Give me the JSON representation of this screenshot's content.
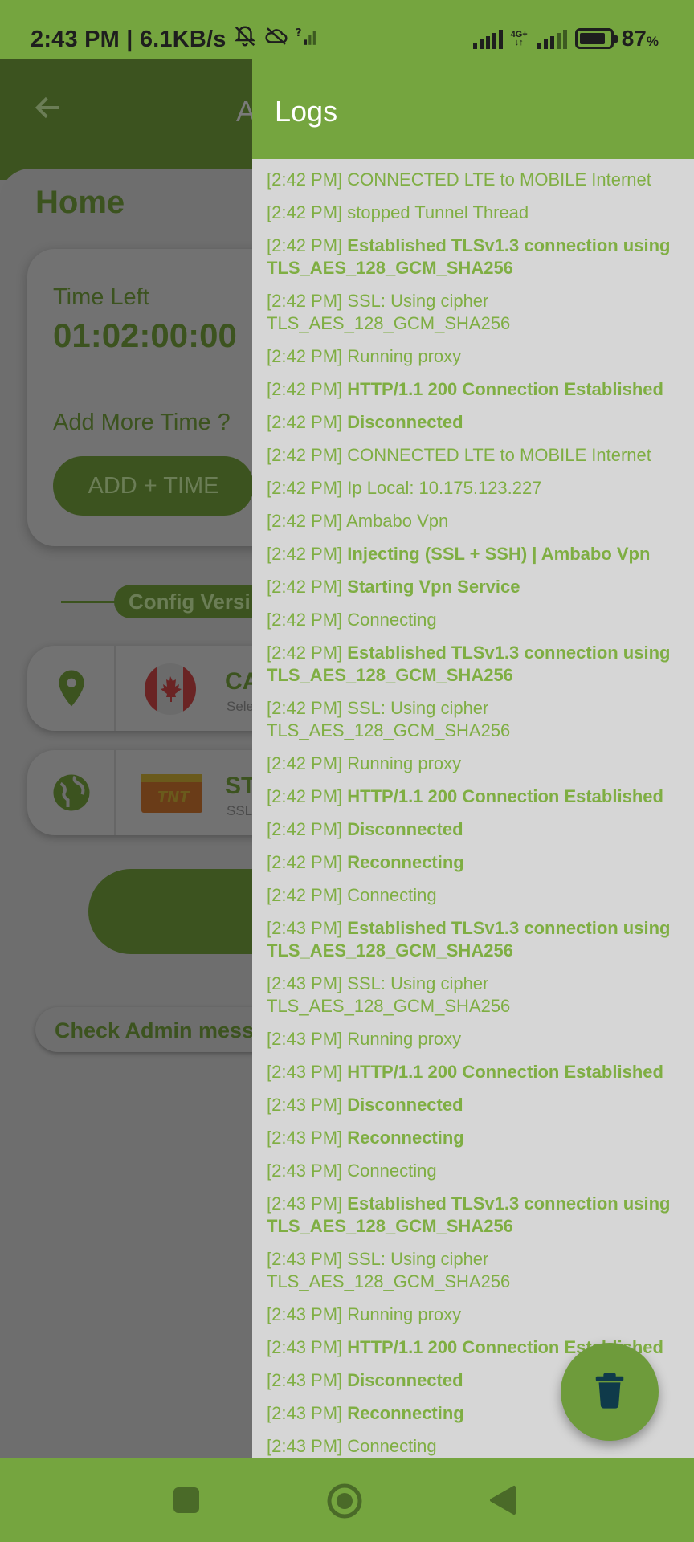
{
  "status_bar": {
    "time_speed": "2:43 PM | 6.1KB/s",
    "network_type": "4G+",
    "battery_percent": "87",
    "battery_unit": "%",
    "battery_level": 0.87
  },
  "background_app": {
    "title_fragment": "A",
    "home_title": "Home",
    "time_left_label": "Time Left",
    "time_left_value": "01:02:00:00",
    "add_more_time_label": "Add More Time ?",
    "add_time_button": "ADD + TIME",
    "config_version_label": "Config Versi",
    "server": {
      "code": "CA",
      "sub": "Sele"
    },
    "payload": {
      "code": "ST",
      "sub": "SSL"
    },
    "admin_message": "Check Admin messa"
  },
  "logs": {
    "title": "Logs",
    "entries": [
      {
        "time": "[2:42 PM]",
        "message": "CONNECTED LTE to MOBILE Internet",
        "bold": false
      },
      {
        "time": "[2:42 PM]",
        "message": "stopped Tunnel Thread",
        "bold": false
      },
      {
        "time": "[2:42 PM]",
        "message": "Established TLSv1.3 connection using TLS_AES_128_GCM_SHA256",
        "bold": true
      },
      {
        "time": "[2:42 PM]",
        "message": "SSL: Using cipher TLS_AES_128_GCM_SHA256",
        "bold": false
      },
      {
        "time": "[2:42 PM]",
        "message": "Running proxy",
        "bold": false
      },
      {
        "time": "[2:42 PM]",
        "message": "HTTP/1.1 200 Connection Established",
        "bold": true
      },
      {
        "time": "[2:42 PM]",
        "message": "Disconnected",
        "bold": true
      },
      {
        "time": "[2:42 PM]",
        "message": "CONNECTED LTE to MOBILE Internet",
        "bold": false
      },
      {
        "time": "[2:42 PM]",
        "message": "Ip Local: 10.175.123.227",
        "bold": false
      },
      {
        "time": "[2:42 PM]",
        "message": "Ambabo Vpn",
        "bold": false
      },
      {
        "time": "[2:42 PM]",
        "message": "Injecting (SSL + SSH) | Ambabo Vpn",
        "bold": true
      },
      {
        "time": "[2:42 PM]",
        "message": "Starting Vpn Service",
        "bold": true
      },
      {
        "time": "[2:42 PM]",
        "message": "Connecting",
        "bold": false
      },
      {
        "time": "[2:42 PM]",
        "message": "Established TLSv1.3 connection using TLS_AES_128_GCM_SHA256",
        "bold": true
      },
      {
        "time": "[2:42 PM]",
        "message": "SSL: Using cipher TLS_AES_128_GCM_SHA256",
        "bold": false
      },
      {
        "time": "[2:42 PM]",
        "message": "Running proxy",
        "bold": false
      },
      {
        "time": "[2:42 PM]",
        "message": "HTTP/1.1 200 Connection Established",
        "bold": true
      },
      {
        "time": "[2:42 PM]",
        "message": "Disconnected",
        "bold": true
      },
      {
        "time": "[2:42 PM]",
        "message": "Reconnecting",
        "bold": true
      },
      {
        "time": "[2:42 PM]",
        "message": "Connecting",
        "bold": false
      },
      {
        "time": "[2:43 PM]",
        "message": "Established TLSv1.3 connection using TLS_AES_128_GCM_SHA256",
        "bold": true
      },
      {
        "time": "[2:43 PM]",
        "message": "SSL: Using cipher TLS_AES_128_GCM_SHA256",
        "bold": false
      },
      {
        "time": "[2:43 PM]",
        "message": "Running proxy",
        "bold": false
      },
      {
        "time": "[2:43 PM]",
        "message": "HTTP/1.1 200 Connection Established",
        "bold": true
      },
      {
        "time": "[2:43 PM]",
        "message": "Disconnected",
        "bold": true
      },
      {
        "time": "[2:43 PM]",
        "message": "Reconnecting",
        "bold": true
      },
      {
        "time": "[2:43 PM]",
        "message": "Connecting",
        "bold": false
      },
      {
        "time": "[2:43 PM]",
        "message": "Established TLSv1.3 connection using TLS_AES_128_GCM_SHA256",
        "bold": true
      },
      {
        "time": "[2:43 PM]",
        "message": "SSL: Using cipher TLS_AES_128_GCM_SHA256",
        "bold": false
      },
      {
        "time": "[2:43 PM]",
        "message": "Running proxy",
        "bold": false
      },
      {
        "time": "[2:43 PM]",
        "message": "HTTP/1.1 200 Connection Established",
        "bold": true
      },
      {
        "time": "[2:43 PM]",
        "message": "Disconnected",
        "bold": true
      },
      {
        "time": "[2:43 PM]",
        "message": "Reconnecting",
        "bold": true
      },
      {
        "time": "[2:43 PM]",
        "message": "Connecting",
        "bold": false
      }
    ]
  },
  "icons": {
    "mute": "bell-off-icon",
    "cloud": "cloud-off-icon",
    "signal": "signal-icon",
    "battery": "battery-icon",
    "back": "arrow-back-icon",
    "location": "location-pin-icon",
    "globe": "globe-icon",
    "flag": "canada-flag-icon",
    "carrier": "tnt-logo-icon",
    "delete": "trash-icon",
    "nav_recent": "square-icon",
    "nav_home": "circle-icon",
    "nav_back": "triangle-back-icon"
  },
  "colors": {
    "accent": "#75a53f",
    "log_text": "#7fae43",
    "drawer_bg": "#d6d6d6",
    "dark_green": "#3c531f"
  }
}
